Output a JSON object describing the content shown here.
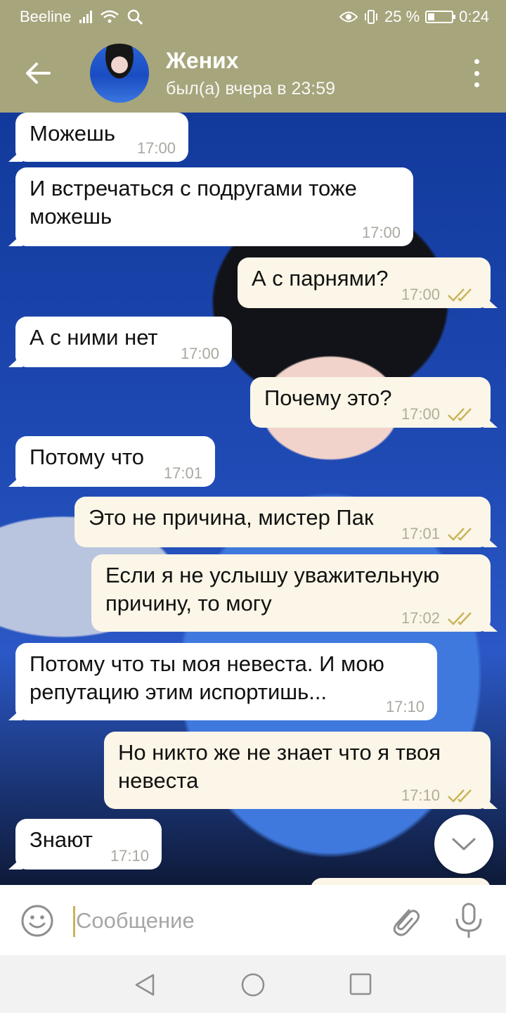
{
  "status_bar": {
    "carrier": "Beeline",
    "battery": "25 %",
    "time": "0:24"
  },
  "header": {
    "name": "Жених",
    "status": "был(а) вчера в 23:59"
  },
  "messages": [
    {
      "dir": "in",
      "text": "Можешь",
      "time": "17:00"
    },
    {
      "dir": "in",
      "text": "И встречаться с подругами тоже можешь",
      "time": "17:00"
    },
    {
      "dir": "out",
      "text": "А с парнями?",
      "time": "17:00"
    },
    {
      "dir": "in",
      "text": "А с ними нет",
      "time": "17:00"
    },
    {
      "dir": "out",
      "text": "Почему это?",
      "time": "17:00"
    },
    {
      "dir": "in",
      "text": "Потому что",
      "time": "17:01"
    },
    {
      "dir": "out",
      "text": "Это не причина, мистер Пак",
      "time": "17:01"
    },
    {
      "dir": "out",
      "text": "Если я не услышу уважительную причину, то могу",
      "time": "17:02"
    },
    {
      "dir": "in",
      "text": "Потому что ты моя невеста. И мою репутацию этим испортишь...",
      "time": "17:10"
    },
    {
      "dir": "out",
      "text": "Но никто же не знает что я твоя невеста",
      "time": "17:10"
    },
    {
      "dir": "in",
      "text": "Знают",
      "time": "17:10"
    }
  ],
  "input": {
    "placeholder": "Сообщение"
  },
  "colors": {
    "header_bg": "#a7a57c",
    "bubble_in": "#ffffff",
    "bubble_out": "#fbf6e7",
    "read_checks": "#c9b45a"
  },
  "icons": [
    "back-arrow-icon",
    "more-vert-icon",
    "double-check-icon",
    "chevron-down-icon",
    "emoji-icon",
    "paperclip-icon",
    "microphone-icon",
    "nav-back-icon",
    "nav-home-icon",
    "nav-recent-icon"
  ]
}
